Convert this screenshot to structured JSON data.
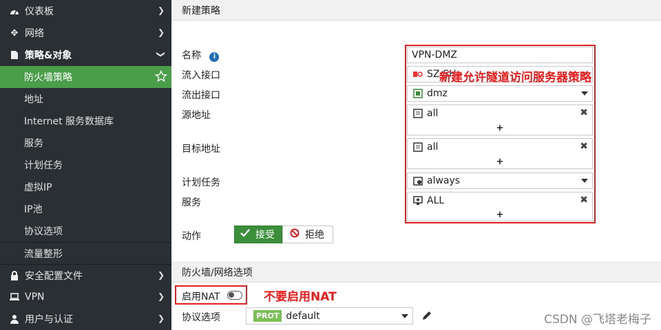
{
  "sidebar": {
    "items": [
      {
        "label": "仪表板",
        "icon": "dashboard-icon"
      },
      {
        "label": "网络",
        "icon": "network-icon"
      },
      {
        "label": "策略&对象",
        "icon": "policy-icon"
      },
      {
        "label": "防火墙策略"
      },
      {
        "label": "地址"
      },
      {
        "label": "Internet 服务数据库"
      },
      {
        "label": "服务"
      },
      {
        "label": "计划任务"
      },
      {
        "label": "虚拟IP"
      },
      {
        "label": "IP池"
      },
      {
        "label": "协议选项"
      },
      {
        "label": "流量整形"
      },
      {
        "label": "安全配置文件",
        "icon": "lock-icon"
      },
      {
        "label": "VPN",
        "icon": "monitor-icon"
      },
      {
        "label": "用户与认证",
        "icon": "user-icon"
      }
    ]
  },
  "header": {
    "title": "新建策略"
  },
  "form": {
    "name_label": "名称",
    "name_value": "VPN-DMZ",
    "incoming_label": "流入接口",
    "incoming_value": "SZ-SH",
    "outgoing_label": "流出接口",
    "outgoing_value": "dmz",
    "source_label": "源地址",
    "source_value": "all",
    "destination_label": "目标地址",
    "destination_value": "all",
    "schedule_label": "计划任务",
    "schedule_value": "always",
    "service_label": "服务",
    "service_value": "ALL",
    "plus": "+",
    "remove": "✖",
    "action_label": "动作",
    "accept_label": "接受",
    "deny_label": "拒绝"
  },
  "section": {
    "title": "防火墙/网络选项",
    "nat_label": "启用NAT",
    "protocol_label": "协议选项",
    "protocol_badge": "PROT",
    "protocol_value": "default"
  },
  "annotations": {
    "policy_note": "新建允许隧道访问服务器策略",
    "nat_note": "不要启用NAT"
  },
  "watermark": "CSDN @飞塔老梅子",
  "colors": {
    "sidebar_bg": "#2a2f33",
    "active_green": "#4a9e4a",
    "accept_green": "#3b8f3b",
    "annotation_red": "#e81b1b"
  }
}
